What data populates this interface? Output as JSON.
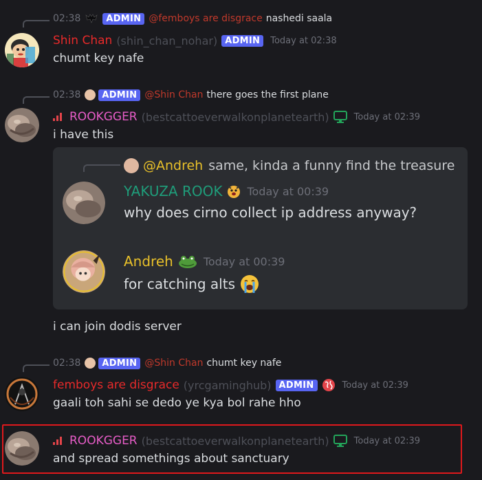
{
  "admin_badge": "ADMIN",
  "messages": [
    {
      "reply": {
        "time": "02:38",
        "mention": "@femboys are disgrace",
        "text": "nashedi saala"
      },
      "username": "Shin Chan",
      "username_color": "#e82a2a",
      "handle": "(shin_chan_nohar)",
      "timestamp": "Today at 02:38",
      "text": "chumt key nafe"
    },
    {
      "reply": {
        "time": "02:38",
        "mention": "@Shin Chan",
        "text": "there goes the first plane"
      },
      "username": "ROOKGGER",
      "username_color": "#e85dc8",
      "handle": "(bestcattoeverwalkonplanetearth)",
      "timestamp": "Today at 02:39",
      "text": "i have this",
      "embed": {
        "reply_mention": "@Andreh",
        "reply_text": "same, kinda a funny find the treasure",
        "entries": [
          {
            "username": "YAKUZA ROOK",
            "username_color": "#1f9d7a",
            "timestamp": "Today at 00:39",
            "text": "why does cirno collect ip address anyway?"
          },
          {
            "username": "Andreh",
            "username_color": "#e8c02a",
            "timestamp": "Today at 00:39",
            "text": "for catching alts"
          }
        ]
      }
    },
    {
      "username": "",
      "text": "i can join dodis server"
    },
    {
      "reply": {
        "time": "02:38",
        "mention": "@Shin Chan",
        "text": "chumt key nafe"
      },
      "username": "femboys are disgrace",
      "username_color": "#e82a2a",
      "handle": "(yrcgaminghub)",
      "timestamp": "Today at 02:39",
      "text": "gaali toh sahi se dedo ye kya bol rahe hho"
    },
    {
      "username": "ROOKGGER",
      "username_color": "#e85dc8",
      "handle": "(bestcattoeverwalkonplanetearth)",
      "timestamp": "Today at 02:39",
      "text": "and spread somethings about sanctuary"
    }
  ],
  "colors": {
    "background": "#1a1a1e",
    "embed_bg": "#2b2d31",
    "admin_badge": "#5865f2",
    "highlight_border": "#e0191c",
    "mention": "#c0392b"
  },
  "icons": [
    "bat-icon",
    "signal-icon",
    "desktop-icon",
    "globe-icon",
    "crying-emoji",
    "frog-emoji",
    "face-emoji"
  ]
}
